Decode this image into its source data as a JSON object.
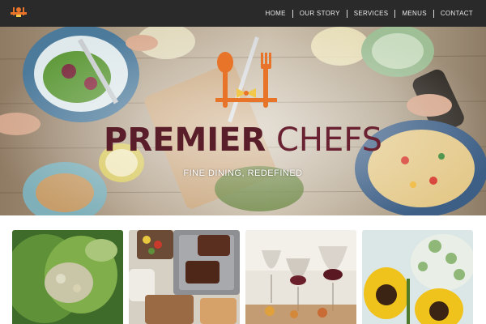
{
  "brand": {
    "title_part1": "PREMIER",
    "title_part2": "CHEFS",
    "tagline": "FINE DINING, REDEFINED",
    "logo_icon": "fork-spoon-knife-logo",
    "accent_color": "#e8742a",
    "title_color": "#5a1d2a"
  },
  "nav": {
    "items": [
      {
        "label": "HOME"
      },
      {
        "label": "OUR STORY"
      },
      {
        "label": "SERVICES"
      },
      {
        "label": "MENUS"
      },
      {
        "label": "CONTACT"
      }
    ],
    "background": "#2a2a2a"
  },
  "gallery": {
    "tiles": [
      {
        "icon": "salad-plate-photo"
      },
      {
        "icon": "grilled-meat-tray-photo"
      },
      {
        "icon": "wine-glasses-photo"
      },
      {
        "icon": "sunflowers-photo"
      }
    ]
  }
}
